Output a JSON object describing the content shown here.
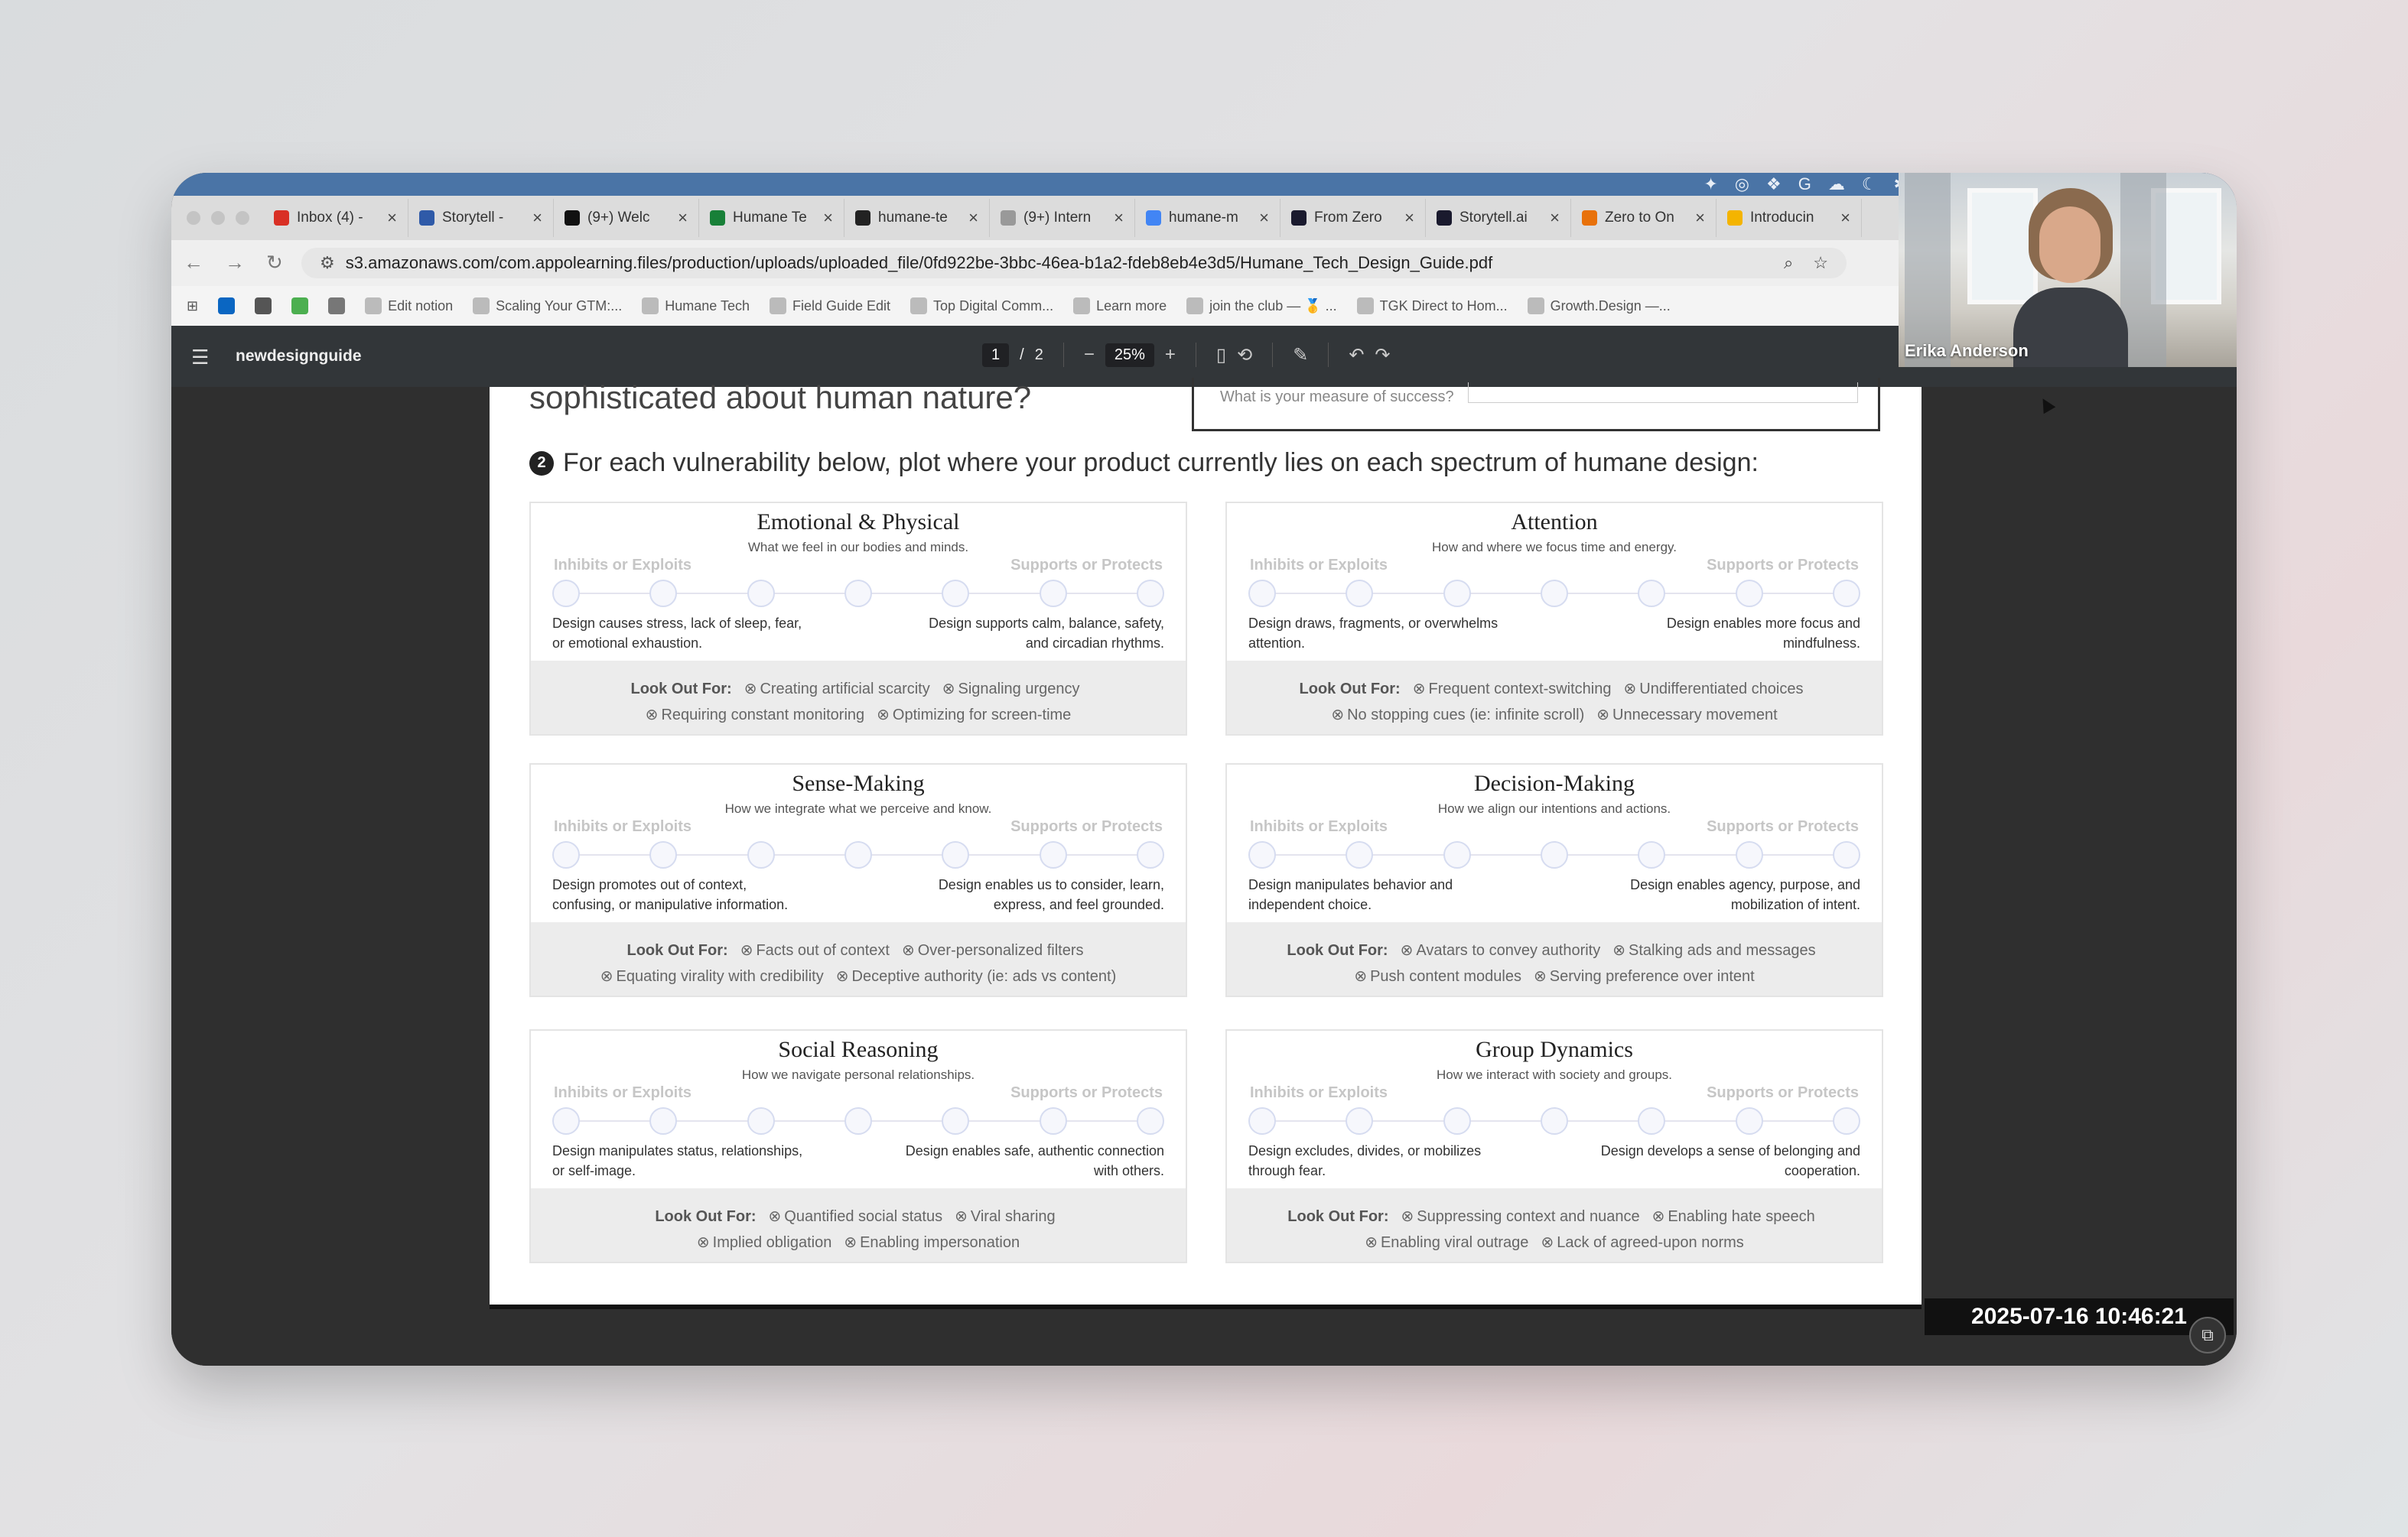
{
  "browser": {
    "tabs": [
      {
        "label": "Inbox (4) -",
        "color": "#d93025"
      },
      {
        "label": "Storytell -",
        "color": "#2f5aa8"
      },
      {
        "label": "(9+) Welc",
        "color": "#111111"
      },
      {
        "label": "Humane Te",
        "color": "#188038"
      },
      {
        "label": "humane-te",
        "color": "#222222"
      },
      {
        "label": "(9+) Intern",
        "color": "#999999"
      },
      {
        "label": "humane-m",
        "color": "#4285f4"
      },
      {
        "label": "From Zero",
        "color": "#1a1a2e"
      },
      {
        "label": "Storytell.ai",
        "color": "#1a1a2e"
      },
      {
        "label": "Zero to On",
        "color": "#e8710a"
      },
      {
        "label": "Introducin",
        "color": "#f4b400"
      }
    ],
    "url": "s3.amazonaws.com/com.appolearning.files/production/uploads/uploaded_file/0fd922be-3bbc-46ea-b1a2-fdeb8eb4e3d5/Humane_Tech_Design_Guide.pdf",
    "bookmarks": [
      "Edit notion",
      "Scaling Your GTM:...",
      "Humane Tech",
      "Field Guide Edit",
      "Top Digital Comm...",
      "Learn more",
      "join the club — 🥇 ...",
      "TGK Direct to Hom...",
      "Growth.Design —..."
    ]
  },
  "pdf": {
    "doc_name": "newdesignguide",
    "page_current": "1",
    "page_separator": "/",
    "page_total": "2",
    "zoom": "25%"
  },
  "page": {
    "heading_cut": "sophisticated about human nature?",
    "success_question": "What is your measure of success?",
    "prompt_number": "2",
    "prompt": "For each vulnerability below, plot where your product currently lies on each spectrum of humane design:",
    "scale_left": "Inhibits or Exploits",
    "scale_right": "Supports or Protects",
    "look_out_label": "Look Out For:",
    "cards": [
      {
        "title": "Emotional & Physical",
        "subtitle": "What we feel in our bodies and minds.",
        "left_desc": "Design causes stress, lack of sleep, fear, or emotional exhaustion.",
        "right_desc": "Design supports calm, balance, safety, and circadian rhythms.",
        "row1": [
          "Creating artificial scarcity",
          "Signaling urgency"
        ],
        "row2": [
          "Requiring constant monitoring",
          "Optimizing for screen-time"
        ]
      },
      {
        "title": "Attention",
        "subtitle": "How and where we focus time and energy.",
        "left_desc": "Design draws, fragments, or overwhelms attention.",
        "right_desc": "Design enables more focus and mindfulness.",
        "row1": [
          "Frequent context-switching",
          "Undifferentiated choices"
        ],
        "row2": [
          "No stopping cues (ie: infinite scroll)",
          "Unnecessary movement"
        ]
      },
      {
        "title": "Sense-Making",
        "subtitle": "How we integrate what we perceive and know.",
        "left_desc": "Design promotes out of context, confusing, or manipulative information.",
        "right_desc": "Design enables us to consider, learn, express, and feel grounded.",
        "row1": [
          "Facts out of context",
          "Over-personalized filters"
        ],
        "row2": [
          "Equating virality with credibility",
          "Deceptive authority (ie: ads vs content)"
        ]
      },
      {
        "title": "Decision-Making",
        "subtitle": "How we align our intentions and actions.",
        "left_desc": "Design manipulates behavior and independent choice.",
        "right_desc": "Design enables agency, purpose, and mobilization of intent.",
        "row1": [
          "Avatars to convey authority",
          "Stalking ads and messages"
        ],
        "row2": [
          "Push content modules",
          "Serving preference over intent"
        ]
      },
      {
        "title": "Social Reasoning",
        "subtitle": "How we navigate personal relationships.",
        "left_desc": "Design manipulates status, relationships, or self-image.",
        "right_desc": "Design enables safe, authentic connection with others.",
        "row1": [
          "Quantified social status",
          "Viral sharing"
        ],
        "row2": [
          "Implied obligation",
          "Enabling impersonation"
        ]
      },
      {
        "title": "Group Dynamics",
        "subtitle": "How we interact with society and groups.",
        "left_desc": "Design excludes, divides, or mobilizes through fear.",
        "right_desc": "Design develops a sense of belonging and cooperation.",
        "row1": [
          "Suppressing context and nuance",
          "Enabling hate speech"
        ],
        "row2": [
          "Enabling viral outrage",
          "Lack of agreed-upon norms"
        ]
      }
    ]
  },
  "webcam": {
    "name": "Erika Anderson"
  },
  "timestamp": "2025-07-16  10:46:21"
}
